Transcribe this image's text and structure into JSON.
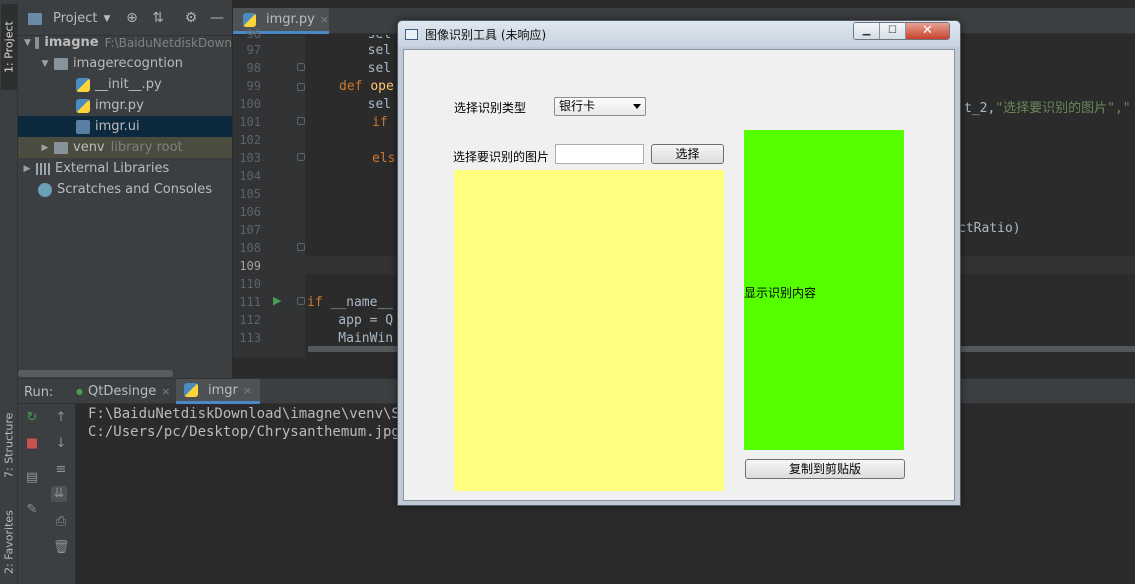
{
  "ide": {
    "left_strip": {
      "project_tab": "1: Project",
      "structure_tab": "7: Structure",
      "favorites_tab": "2: Favorites"
    },
    "project_panel": {
      "title": "Project",
      "tree": [
        {
          "label": "imagne",
          "extra": "F:\\BaiduNetdiskDown"
        },
        {
          "label": "imagerecogntion"
        },
        {
          "label": "__init__.py"
        },
        {
          "label": "imgr.py"
        },
        {
          "label": "imgr.ui"
        },
        {
          "label": "venv",
          "extra": "library root"
        },
        {
          "label": "External Libraries"
        },
        {
          "label": "Scratches and Consoles"
        }
      ]
    },
    "editor": {
      "tab_label": "imgr.py",
      "line_numbers": [
        "96",
        "97",
        "98",
        "99",
        "100",
        "101",
        "102",
        "103",
        "104",
        "105",
        "106",
        "107",
        "108",
        "109",
        "110",
        "111",
        "112",
        "113"
      ],
      "lines": {
        "l96": "        sel",
        "l97": "        sel",
        "l98": "        sel",
        "l99_kw": "def",
        "l99_fn": "ope",
        "l100": "        sel",
        "l101_kw": "if",
        "l103_kw": "els",
        "l111_kw": "if",
        "l111_rest": " __name__",
        "l112": "    app = Q",
        "l113": "    MainWin"
      },
      "right_fragment_1a": "t_2,",
      "right_fragment_1b": "\"选择要识别的图片\",\"",
      "right_fragment_2": "ctRatio)"
    },
    "run_panel": {
      "label": "Run:",
      "tabs": [
        "QtDesinge",
        "imgr"
      ],
      "console_lines": [
        "F:\\BaiduNetdiskDownload\\imagne\\venv\\Scr",
        "C:/Users/pc/Desktop/Chrysanthemum.jpg"
      ]
    }
  },
  "qt_window": {
    "title": "图像识别工具 (未响应)",
    "select_type_label": "选择识别类型",
    "type_combo_value": "银行卡",
    "select_image_label": "选择要识别的图片",
    "path_input_value": "",
    "choose_button": "选择",
    "result_label": "显示识别内容",
    "copy_button": "复制到剪贴版",
    "colors": {
      "image_area": "#ffff80",
      "result_area": "#55ff00"
    }
  }
}
